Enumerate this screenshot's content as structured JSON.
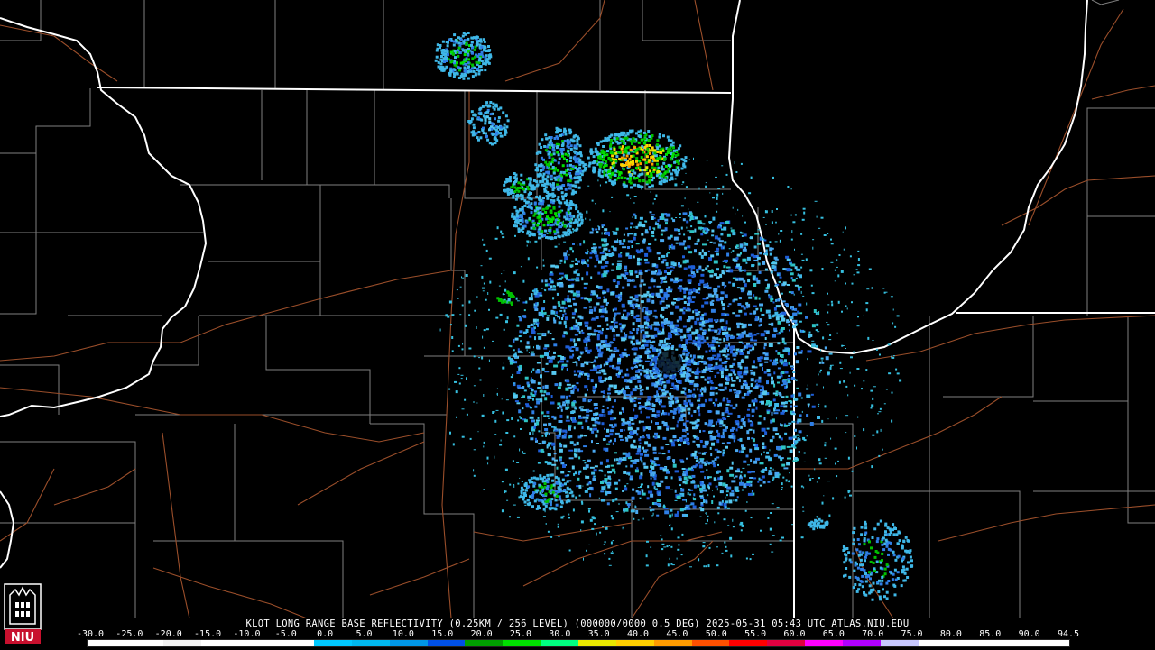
{
  "caption": "KLOT LONG RANGE BASE REFLECTIVITY (0.25KM / 256 LEVEL) (000000/0000 0.5 DEG) 2025-05-31 05:43 UTC  ATLAS.NIU.EDU",
  "logo_text": "NIU",
  "scale": {
    "tick_labels": [
      "-30.0",
      "-25.0",
      "-20.0",
      "-15.0",
      "-10.0",
      "-5.0",
      "0.0",
      "5.0",
      "10.0",
      "15.0",
      "20.0",
      "25.0",
      "30.0",
      "35.0",
      "40.0",
      "45.0",
      "50.0",
      "55.0",
      "60.0",
      "65.0",
      "70.0",
      "75.0",
      "80.0",
      "85.0",
      "90.0",
      "94.5"
    ],
    "colors": [
      "#ffffff",
      "#ffffff",
      "#f2f2f2",
      "#ffffff",
      "#ffffff",
      "#ffffff",
      "#00c8ff",
      "#00b8ee",
      "#0096e6",
      "#0050e6",
      "#00a000",
      "#00e000",
      "#00ff80",
      "#e8e800",
      "#ffd000",
      "#ff9c00",
      "#ff5000",
      "#ff0000",
      "#e00040",
      "#ff00ff",
      "#b000ff",
      "#c8c8ff",
      "#ffffff",
      "#ffffff",
      "#ffffff",
      "#ffffff"
    ]
  },
  "map_colors": {
    "state_border": "#ffffff",
    "county_border": "#7f7f7f",
    "road": "#9a4e2a",
    "background": "#000000"
  },
  "radar": {
    "site_label": "KLOT",
    "dominant_reflectivity_dbz": [
      5.0,
      15.0
    ],
    "max_reflectivity_dbz": 45.0
  }
}
